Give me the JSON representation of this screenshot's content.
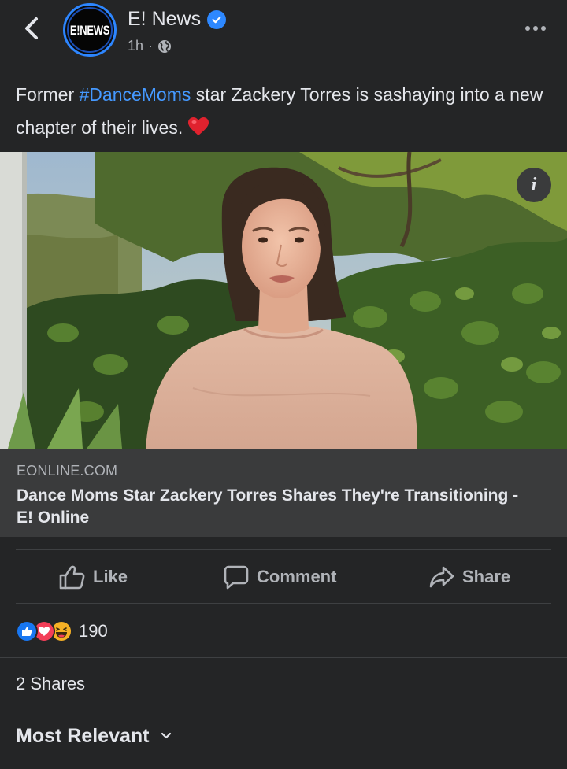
{
  "post": {
    "page_name": "E! News",
    "avatar_text": "E!NEWS",
    "time": "1h",
    "meta_separator": "·",
    "caption": {
      "prefix": "Former ",
      "hashtag": "#DanceMoms",
      "suffix": " star Zackery Torres is sashaying into a new chapter of their lives."
    }
  },
  "link_preview": {
    "domain": "EONLINE.COM",
    "title": "Dance Moms Star Zackery Torres Shares They're Transitioning - E! Online"
  },
  "actions": {
    "like": "Like",
    "comment": "Comment",
    "share": "Share"
  },
  "stats": {
    "reaction_count": "190",
    "shares": "2 Shares"
  },
  "comments": {
    "sort_label": "Most Relevant"
  },
  "colors": {
    "background": "#242526",
    "link_card": "#3a3b3c",
    "accent_blue": "#2d88ff",
    "hashtag": "#4599ff",
    "like_reaction": "#1877f2",
    "love_reaction": "#f33e58",
    "haha_reaction": "#f7b125"
  },
  "icons": {
    "back": "chevron-left-icon",
    "verified": "verified-badge-icon",
    "privacy": "globe-icon",
    "more": "more-options-icon",
    "info": "info-icon",
    "like": "thumbs-up-icon",
    "comment": "comment-bubble-icon",
    "share": "share-arrow-icon",
    "sort": "chevron-down-icon"
  }
}
